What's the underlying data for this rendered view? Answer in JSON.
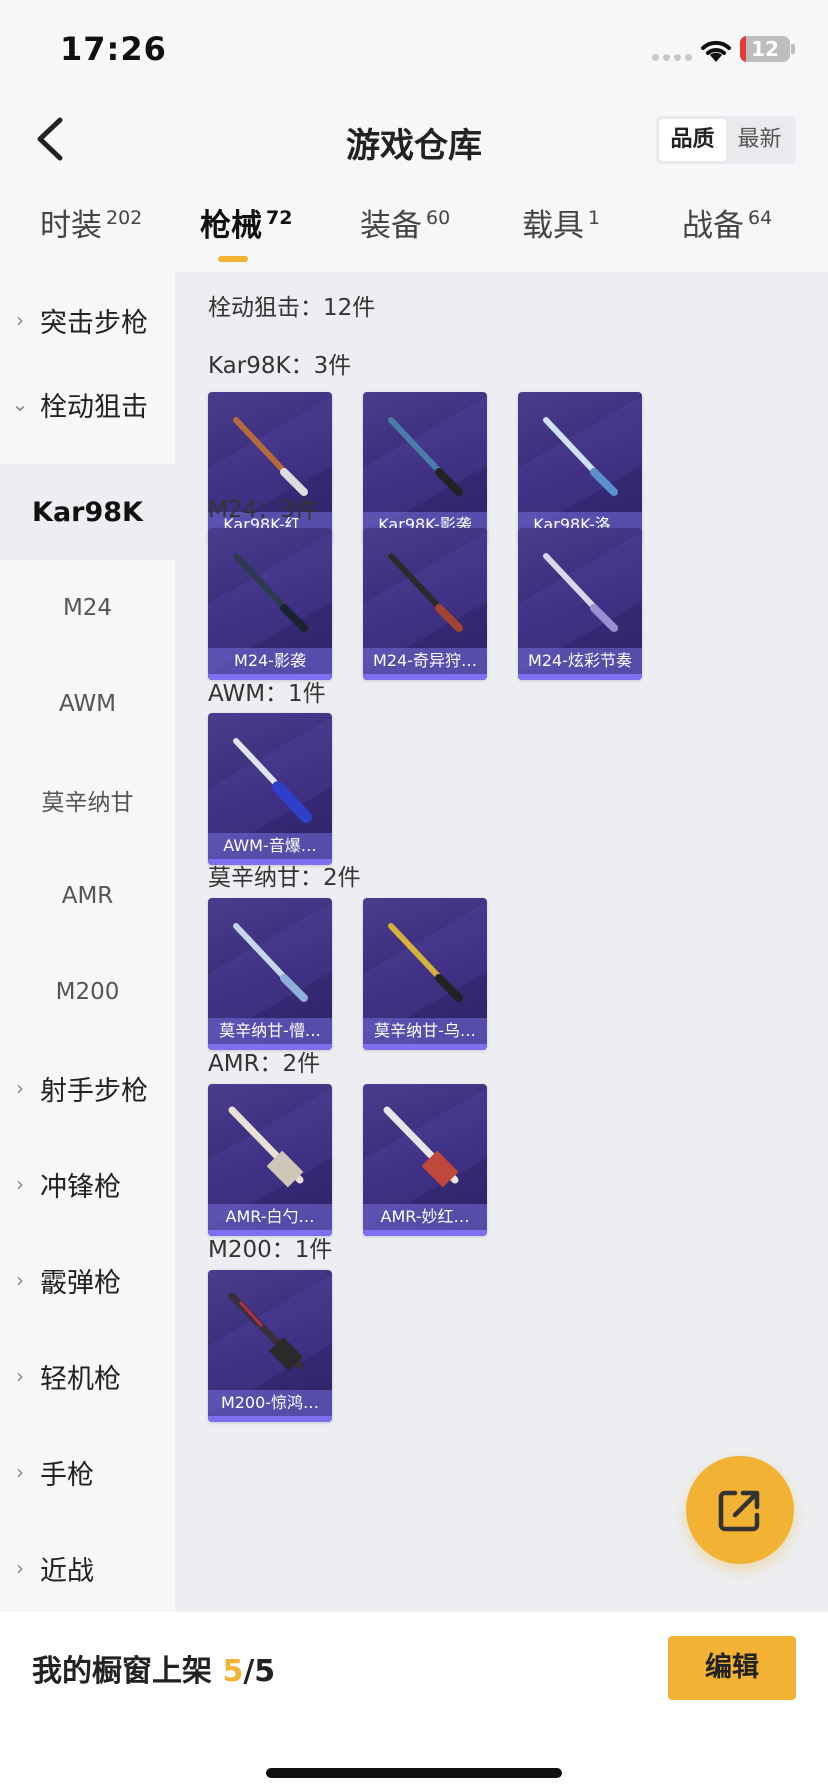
{
  "status_bar": {
    "time": "17:26",
    "battery": "12"
  },
  "header": {
    "title": "游戏仓库",
    "sort_options": [
      "品质",
      "最新"
    ]
  },
  "tabs": [
    {
      "label": "时装",
      "count": "202"
    },
    {
      "label": "枪械",
      "count": "72"
    },
    {
      "label": "装备",
      "count": "60"
    },
    {
      "label": "载具",
      "count": "1"
    },
    {
      "label": "战备",
      "count": "64"
    }
  ],
  "sidebar": {
    "items": [
      {
        "label": "突击步枪",
        "chevron": "›"
      },
      {
        "label": "栓动狙击",
        "chevron": "⌄"
      },
      {
        "label": "Kar98K"
      },
      {
        "label": "M24"
      },
      {
        "label": "AWM"
      },
      {
        "label": "莫辛纳甘"
      },
      {
        "label": "AMR"
      },
      {
        "label": "M200"
      },
      {
        "label": "射手步枪",
        "chevron": "›"
      },
      {
        "label": "冲锋枪",
        "chevron": "›"
      },
      {
        "label": "霰弹枪",
        "chevron": "›"
      },
      {
        "label": "轻机枪",
        "chevron": "›"
      },
      {
        "label": "手枪",
        "chevron": "›"
      },
      {
        "label": "近战",
        "chevron": "›"
      }
    ]
  },
  "content": {
    "category_header": "栓动狙击：12件",
    "groups": [
      {
        "header": "Kar98K：3件",
        "items": [
          "Kar98K-红…",
          "Kar98K-影袭",
          "Kar98K-洛…"
        ]
      },
      {
        "header": "M24：3件",
        "items": [
          "M24-影袭",
          "M24-奇异狩…",
          "M24-炫彩节奏"
        ]
      },
      {
        "header": "AWM：1件",
        "items": [
          "AWM-音爆…"
        ]
      },
      {
        "header": "莫辛纳甘：2件",
        "items": [
          "莫辛纳甘-懵…",
          "莫辛纳甘-乌…"
        ]
      },
      {
        "header": "AMR：2件",
        "items": [
          "AMR-白勺…",
          "AMR-妙红…"
        ]
      },
      {
        "header": "M200：1件",
        "items": [
          "M200-惊鸿…"
        ]
      }
    ]
  },
  "bottom_bar": {
    "label": "我的橱窗上架",
    "used": "5",
    "total": "/5",
    "edit_label": "编辑"
  },
  "colors": {
    "accent": "#f2b233",
    "card_bg": "#3a2d7b"
  }
}
